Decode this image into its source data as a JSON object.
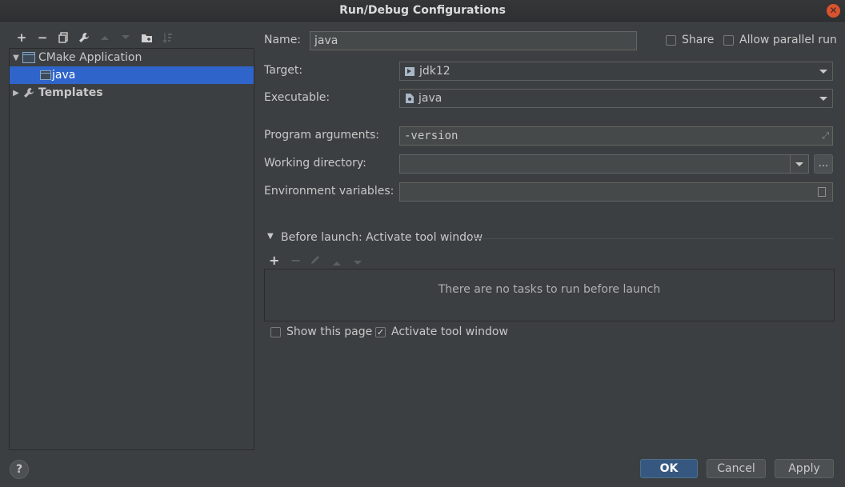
{
  "window": {
    "title": "Run/Debug Configurations"
  },
  "toolbar": {
    "icons": [
      "add-icon",
      "remove-icon",
      "copy-icon",
      "wrench-icon",
      "move-up-icon",
      "move-down-icon",
      "folder-icon",
      "sort-icon"
    ],
    "add": "+",
    "remove": "−"
  },
  "tree": {
    "items": [
      {
        "label": "CMake Application",
        "expanded": true
      },
      {
        "label": "java",
        "selected": true
      },
      {
        "label": "Templates",
        "expanded": false
      }
    ]
  },
  "form": {
    "name_label": "Name:",
    "name_value": "java",
    "share_label": "Share",
    "parallel_label": "Allow parallel run",
    "target_label": "Target:",
    "target_value": "jdk12",
    "executable_label": "Executable:",
    "executable_value": "java",
    "args_label": "Program arguments:",
    "args_value": "-version",
    "workdir_label": "Working directory:",
    "workdir_value": "",
    "browse_label": "...",
    "env_label": "Environment variables:",
    "env_value": ""
  },
  "before_launch": {
    "header": "Before launch: Activate tool window",
    "empty_text": "There are no tasks to run before launch",
    "add": "+",
    "remove": "−",
    "show_page_label": "Show this page",
    "show_page_checked": false,
    "activate_label": "Activate tool window",
    "activate_checked": true
  },
  "buttons": {
    "help": "?",
    "ok": "OK",
    "cancel": "Cancel",
    "apply": "Apply"
  },
  "colors": {
    "accent": "#2f65ca",
    "background": "#3c3f41",
    "primary_button": "#365880"
  }
}
